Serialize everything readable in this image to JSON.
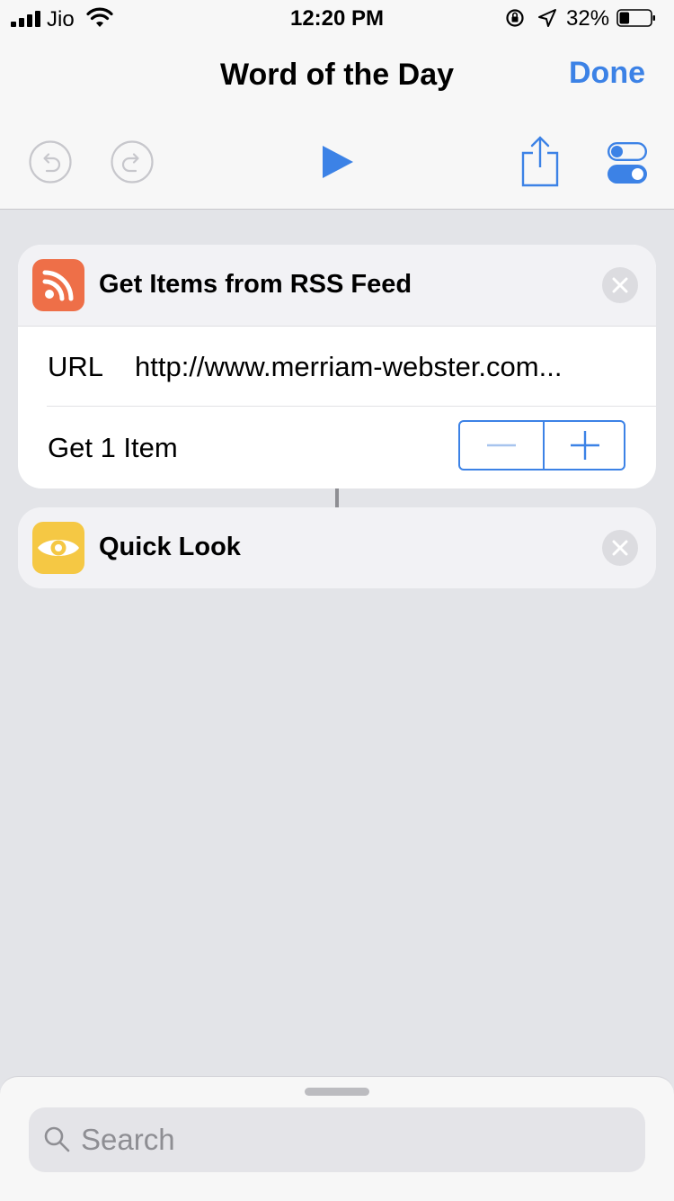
{
  "status_bar": {
    "carrier": "Jio",
    "time": "12:20 PM",
    "battery_percent": "32%",
    "battery_level": 0.32
  },
  "header": {
    "title": "Word of the Day",
    "done_label": "Done"
  },
  "toolbar": {
    "icons": [
      "undo-icon",
      "redo-icon",
      "play-icon",
      "share-icon",
      "settings-toggle-icon"
    ]
  },
  "actions": [
    {
      "title": "Get Items from RSS Feed",
      "icon": "rss-icon",
      "icon_color": "#ee6f48",
      "url_label": "URL",
      "url_value": "http://www.merriam-webster.com...",
      "count_label": "Get 1 Item"
    },
    {
      "title": "Quick Look",
      "icon": "eye-icon",
      "icon_color": "#f5c844"
    }
  ],
  "search": {
    "placeholder": "Search"
  },
  "colors": {
    "accent": "#3c82e6",
    "background": "#e3e4e8"
  }
}
